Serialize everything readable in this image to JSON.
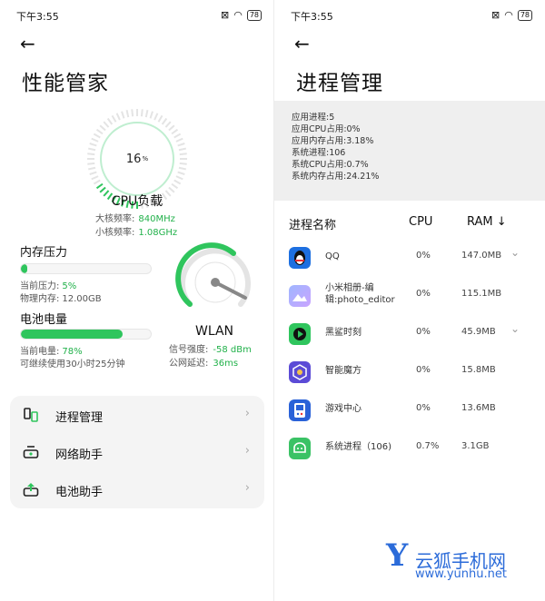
{
  "left": {
    "status": {
      "time": "下午3:55",
      "battery": "78"
    },
    "title": "性能管家",
    "cpu": {
      "percent_value": "16",
      "percent_sign": "%",
      "label": "CPU负载",
      "big_core_label": "大核频率:",
      "big_core_value": "840MHz",
      "small_core_label": "小核频率:",
      "small_core_value": "1.08GHz",
      "load_fraction": 0.16
    },
    "memory": {
      "title": "内存压力",
      "pressure_label": "当前压力:",
      "pressure_value": "5%",
      "physical_label": "物理内存:",
      "physical_value": "12.00GB",
      "fill_fraction": 0.05
    },
    "battery": {
      "title": "电池电量",
      "level_label": "当前电量:",
      "level_value": "78%",
      "remaining": "可继续使用30小时25分钟",
      "fill_fraction": 0.78
    },
    "wlan": {
      "label": "WLAN",
      "signal_label": "信号强度:",
      "signal_value": "-58 dBm",
      "latency_label": "公网延迟:",
      "latency_value": "36ms"
    },
    "menu": [
      {
        "label": "进程管理",
        "icon": "process-icon"
      },
      {
        "label": "网络助手",
        "icon": "router-icon"
      },
      {
        "label": "电池助手",
        "icon": "battery-upload-icon"
      }
    ],
    "colors": {
      "accent": "#2fc55d",
      "value_green": "#21b14a",
      "gauge_gray": "#e4e4e4"
    }
  },
  "right": {
    "status": {
      "time": "下午3:55",
      "battery": "78"
    },
    "title": "进程管理",
    "summary": [
      "应用进程:5",
      "应用CPU占用:0%",
      "应用内存占用:3.18%",
      "系统进程:106",
      "系统CPU占用:0.7%",
      "系统内存占用:24.21%"
    ],
    "columns": {
      "name": "进程名称",
      "cpu": "CPU",
      "ram": "RAM ↓"
    },
    "rows": [
      {
        "name": "QQ",
        "cpu": "0%",
        "ram": "147.0MB",
        "expand": "⌄",
        "icon": "qq-icon"
      },
      {
        "name": "小米相册-编辑:photo_editor",
        "cpu": "0%",
        "ram": "115.1MB",
        "expand": "",
        "icon": "gallery-icon"
      },
      {
        "name": "黑鲨时刻",
        "cpu": "0%",
        "ram": "45.9MB",
        "expand": "⌄",
        "icon": "blackshark-icon"
      },
      {
        "name": "智能魔方",
        "cpu": "0%",
        "ram": "15.8MB",
        "expand": "",
        "icon": "cube-icon"
      },
      {
        "name": "游戏中心",
        "cpu": "0%",
        "ram": "13.6MB",
        "expand": "",
        "icon": "gamepad-icon"
      },
      {
        "name": "系统进程（106)",
        "cpu": "0.7%",
        "ram": "3.1GB",
        "expand": "",
        "icon": "android-icon"
      }
    ]
  },
  "watermark": {
    "brand": "云狐手机网",
    "url": "www.yunhu.net",
    "letter": "Y"
  }
}
